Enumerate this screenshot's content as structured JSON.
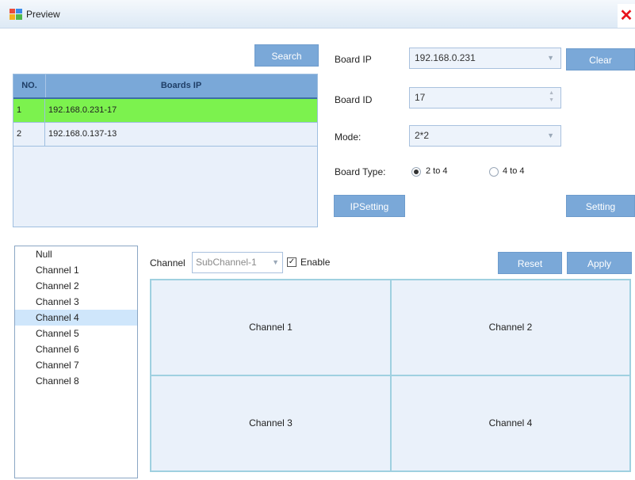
{
  "window": {
    "title": "Preview",
    "close_glyph": "✕"
  },
  "search": {
    "label": "Search"
  },
  "boards_table": {
    "headers": {
      "no": "NO.",
      "ip": "Boards IP"
    },
    "rows": [
      {
        "no": "1",
        "ip": "192.168.0.231-17",
        "selected": true
      },
      {
        "no": "2",
        "ip": "192.168.0.137-13",
        "selected": false
      }
    ]
  },
  "form": {
    "board_ip_label": "Board IP",
    "board_ip_value": "192.168.0.231",
    "clear_label": "Clear",
    "board_id_label": "Board ID",
    "board_id_value": "17",
    "mode_label": "Mode:",
    "mode_value": "2*2",
    "board_type_label": "Board Type:",
    "board_type_options": [
      {
        "label": "2 to 4",
        "checked": true
      },
      {
        "label": "4 to 4",
        "checked": false
      }
    ],
    "ipsetting_label": "IPSetting",
    "setting_label": "Setting"
  },
  "channels": {
    "items": [
      "Null",
      "Channel 1",
      "Channel 2",
      "Channel 3",
      "Channel 4",
      "Channel 5",
      "Channel 6",
      "Channel 7",
      "Channel 8"
    ],
    "selected_index": 4
  },
  "channel_bar": {
    "channel_label": "Channel",
    "subchannel_value": "SubChannel-1",
    "enable_label": "Enable",
    "enable_checked": true,
    "reset_label": "Reset",
    "apply_label": "Apply"
  },
  "grid": {
    "cells": [
      "Channel 1",
      "Channel 2",
      "Channel 3",
      "Channel 4"
    ]
  },
  "colors": {
    "accent": "#7aa8d8",
    "selected_row": "#7cf24e",
    "selected_item": "#cfe6fb",
    "close": "#e8141c"
  }
}
